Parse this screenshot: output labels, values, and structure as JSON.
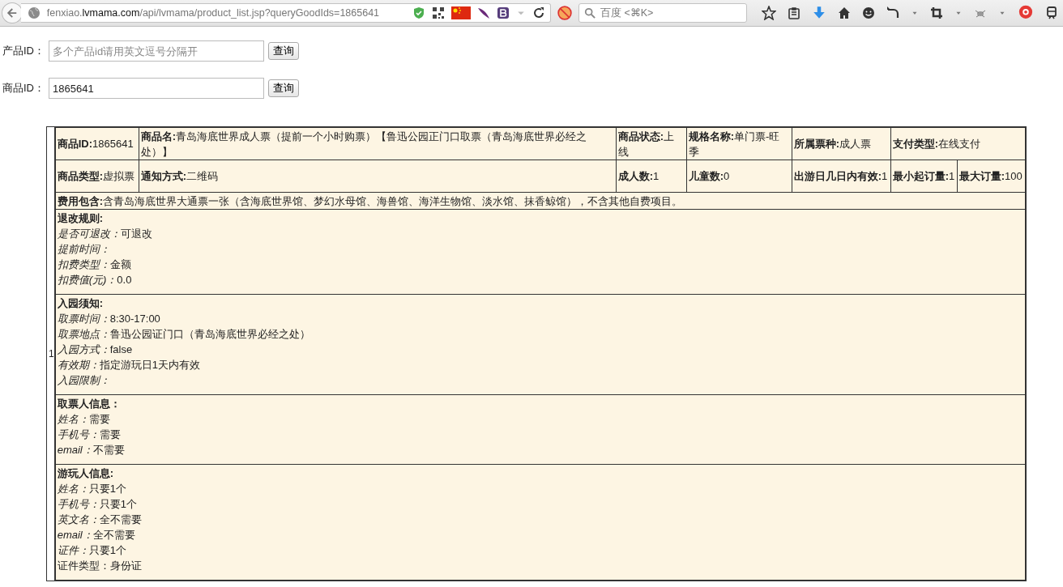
{
  "browser": {
    "url": "fenxiao.**lvmama.com**/api/lvmama/product_list.jsp?queryGoodIds=1865641",
    "search": {
      "placeholder": "百度 <⌘K>"
    }
  },
  "forms": [
    {
      "label": "产品ID：",
      "placeholder": "多个产品id请用英文逗号分隔开",
      "button": "查询"
    },
    {
      "label": "商品ID：",
      "value": "1865641",
      "button": "查询"
    }
  ],
  "results": [
    {
      "index": "1",
      "rows": [
        [
          "**商品ID:**1865641",
          "**商品名:**青岛海底世界成人票（提前一个小时购票）【鲁迅公园正门口取票（青岛海底世界必经之处）】",
          "**商品状态:**上线",
          "**规格名称:**单门票-旺季",
          "**所属票种:**成人票",
          {
            "text": "**支付类型:**在线支付",
            "colspan": 2
          }
        ],
        [
          "**商品类型:**虚拟票",
          "**通知方式:**二维码",
          "**成人数:**1",
          "**儿童数:**0",
          "**出游日几日内有效:**1",
          "**最小起订量:**1",
          "**最大订量:**100"
        ]
      ],
      "fees": "**费用包含:**含青岛海底世界大通票一张（含海底世界馆、梦幻水母馆、海兽馆、海洋生物馆、淡水馆、抹香鲸馆），不含其他自费项目。",
      "sections": [
        {
          "heading": "退改规则:",
          "lines": [
            {
              "label": "是否可退改：",
              "value": "可退改"
            },
            {
              "label": "提前时间："
            },
            {
              "label": "扣费类型：",
              "value": "金额"
            },
            {
              "label": "扣费值(元)：",
              "value": "0.0"
            }
          ]
        },
        {
          "heading": "入园须知:",
          "lines": [
            {
              "label": "取票时间：",
              "value": "8:30-17:00"
            },
            {
              "label": "取票地点：",
              "value": "鲁迅公园证门口（青岛海底世界必经之处）"
            },
            {
              "label": "入园方式：",
              "value": "false"
            },
            {
              "label": "有效期：",
              "value": "指定游玩日1天内有效"
            },
            {
              "label": "入园限制："
            }
          ]
        },
        {
          "heading": "取票人信息：",
          "lines": [
            {
              "label": "姓名：",
              "value": "需要"
            },
            {
              "label": "手机号：",
              "value": "需要"
            },
            {
              "label": "email：",
              "value": "不需要"
            }
          ]
        },
        {
          "heading": "游玩人信息:",
          "lines": [
            {
              "label": "姓名：",
              "value": "只要1个"
            },
            {
              "label": "手机号：",
              "value": "只要1个"
            },
            {
              "label": "英文名：",
              "value": "全不需要"
            },
            {
              "label": "email：",
              "value": "全不需要"
            },
            {
              "label": "证件：",
              "value": "只要1个"
            },
            {
              "value": "证件类型：身份证"
            }
          ]
        }
      ]
    }
  ]
}
